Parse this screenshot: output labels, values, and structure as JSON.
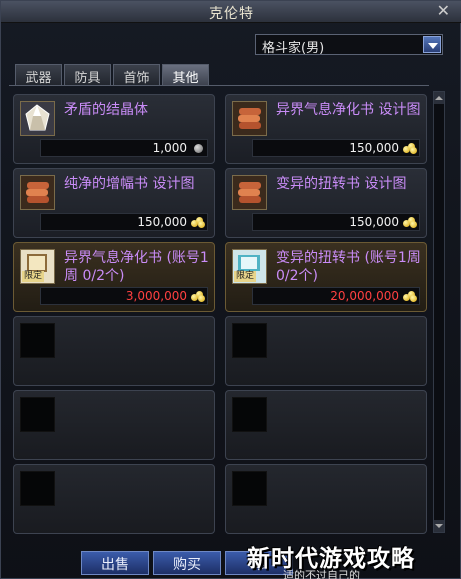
{
  "window": {
    "title": "克伦特",
    "close": "✕"
  },
  "job_select": {
    "value": "格斗家(男)"
  },
  "tabs": [
    {
      "label": "武器",
      "active": false
    },
    {
      "label": "防具",
      "active": false
    },
    {
      "label": "首饰",
      "active": false
    },
    {
      "label": "其他",
      "active": true
    }
  ],
  "items": [
    {
      "name": "矛盾的结晶体",
      "price": "1,000",
      "currency": "coin-gray",
      "limited": false
    },
    {
      "name": "异界气息净化书 设计图",
      "price": "150,000",
      "currency": "gold",
      "limited": false
    },
    {
      "name": "纯净的增幅书 设计图",
      "price": "150,000",
      "currency": "gold",
      "limited": false
    },
    {
      "name": "变异的扭转书 设计图",
      "price": "150,000",
      "currency": "gold",
      "limited": false
    },
    {
      "name": "异界气息净化书 (账号1周 0/2个)",
      "price": "3,000,000",
      "currency": "gold",
      "limited": true,
      "badge": "限定"
    },
    {
      "name": "变异的扭转书 (账号1周 0/2个)",
      "price": "20,000,000",
      "currency": "gold",
      "limited": true,
      "badge": "限定"
    }
  ],
  "buttons": {
    "sell": "出售",
    "buy": "购买",
    "third": "修"
  },
  "watermark": {
    "main": "新时代游戏攻略",
    "sub": "适的不过自己的"
  }
}
